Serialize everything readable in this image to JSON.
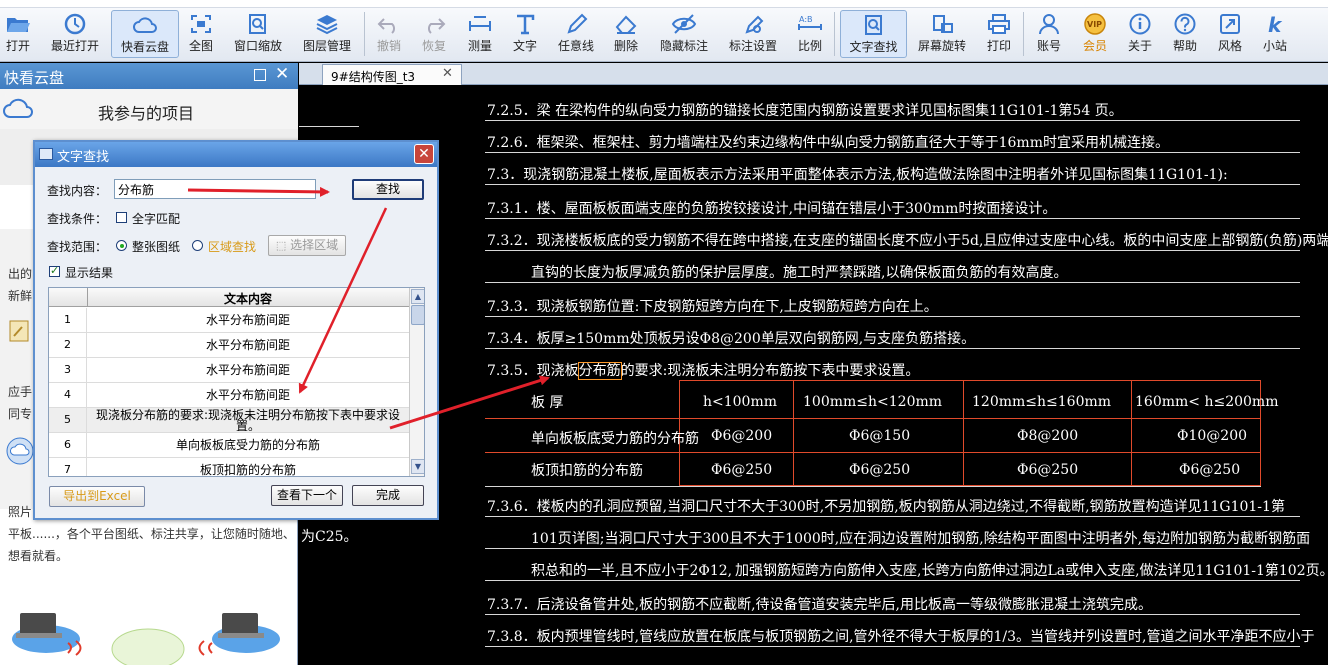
{
  "toolbar": {
    "open": "打开",
    "recent": "最近打开",
    "cloud": "快看云盘",
    "fullview": "全图",
    "window_zoom": "窗口缩放",
    "layer_mgmt": "图层管理",
    "undo": "撤销",
    "redo": "恢复",
    "measure": "测量",
    "text": "文字",
    "freeline": "任意线",
    "delete": "删除",
    "hide_markup": "隐藏标注",
    "markup_settings": "标注设置",
    "scale": "比例",
    "text_find": "文字查找",
    "rotate": "屏幕旋转",
    "print": "打印",
    "account": "账号",
    "vip": "会员",
    "about": "关于",
    "help": "帮助",
    "style": "风格",
    "site": "小站"
  },
  "left_panel": {
    "title": "快看云盘",
    "project_label": "我参与的项目",
    "text_a1": "出的",
    "text_a2": "新鲜",
    "text_b1": "应手",
    "text_b2": "同专",
    "text_c1": "照片",
    "text_c2": "平板......，各个平台图纸、标注共享，让您随时随地、",
    "text_c3": "想看就看。"
  },
  "tab": {
    "label": "9#结构传图_t3",
    "close": "✕"
  },
  "drawing": {
    "lines": [
      "7.2.5．梁 在梁构件的纵向受力钢筋的锚接长度范围内钢筋设置要求详见国标图集11G101-1第54 页。",
      "7.2.6．框架梁、框架柱、剪力墙端柱及约束边缘构件中纵向受力钢筋直径大于等于16mm时宜采用机械连接。",
      "7.3．现浇钢筋混凝土楼板,屋面板表示方法采用平面整体表示方法,板构造做法除图中注明者外详见国标图集11G101-1):",
      "7.3.1．楼、屋面板板面端支座的负筋按铰接设计,中间锚在错层小于300mm时按面接设计。",
      "7.3.2．现浇楼板板底的受力钢筋不得在跨中搭接,在支座的锚固长度不应小于5d,且应伸过支座中心线。板的中间支座上部钢筋(负筋)两端",
      "直钩的长度为板厚减负筋的保护层厚度。施工时严禁踩踏,以确保板面负筋的有效高度。",
      "7.3.3．现浇板钢筋位置:下皮钢筋短跨方向在下,上皮钢筋短跨方向在上。",
      "7.3.4．板厚≥150mm处顶板另设Φ8@200单层双向钢筋网,与支座负筋搭接。",
      "7.3.6．楼板内的孔洞应预留,当洞口尺寸不大于300时,不另加钢筋,板内钢筋从洞边绕过,不得截断,钢筋放置构造详见11G101-1第",
      "101页详图;当洞口尺寸大于300且不大于1000时,应在洞边设置附加钢筋,除结构平面图中注明者外,每边附加钢筋为截断钢筋面",
      "积总和的一半,且不应小于2Φ12,",
      "加强钢筋短跨方向筋伸入支座,长跨方向筋伸过洞边La或伸入支座,做法详见11G101-1第102页。",
      "7.3.7．后浇设备管井处,板的钢筋不应截断,待设备管道安装完毕后,用比板高一等级微膨胀混凝土浇筑完成。",
      "7.3.8．板内预埋管线时,管线应放置在板底与板顶钢筋之间,管外径不得大于板厚的1/3。当管线并列设置时,管道之间水平净距不应小于"
    ],
    "line_735_pre": "7.3.5．现浇板",
    "line_735_hl": "分布筋",
    "line_735_post": "的要求:现浇板未注明分布筋按下表中要求设置。",
    "side_text": "为C25。",
    "table": {
      "headers": [
        "板  厚",
        "h<100mm",
        "100mm≤h<120mm",
        "120mm≤h≤160mm",
        "160mm< h≤200mm"
      ],
      "rows": [
        [
          "单向板板底受力筋的分布筋",
          "Φ6@200",
          "Φ6@150",
          "Φ8@200",
          "Φ10@200"
        ],
        [
          "板顶扣筋的分布筋",
          "Φ6@250",
          "Φ6@250",
          "Φ6@250",
          "Φ6@250"
        ]
      ]
    }
  },
  "dialog": {
    "title": "文字查找",
    "search_label": "查找内容：",
    "search_value": "分布筋",
    "find_button": "查找",
    "condition_label": "查找条件：",
    "whole_match": "全字匹配",
    "range_label": "查找范围：",
    "whole_drawing": "整张图纸",
    "region_find": "区域查找",
    "select_region": "选择区域",
    "show_results": "显示结果",
    "table_header": "文本内容",
    "results": [
      {
        "n": "1",
        "text": "水平分布筋间距"
      },
      {
        "n": "2",
        "text": "水平分布筋间距"
      },
      {
        "n": "3",
        "text": "水平分布筋间距"
      },
      {
        "n": "4",
        "text": "水平分布筋间距"
      },
      {
        "n": "5",
        "text": "现浇板分布筋的要求:现浇板未注明分布筋按下表中要求设置。"
      },
      {
        "n": "6",
        "text": "单向板板底受力筋的分布筋"
      },
      {
        "n": "7",
        "text": "板顶扣筋的分布筋"
      }
    ],
    "export_button": "导出到Excel",
    "next_button": "查看下一个",
    "done_button": "完成"
  },
  "colors": {
    "arrow": "#e0202a",
    "highlight_box": "#ff9a2a",
    "title_bar": "#3c78c5"
  }
}
